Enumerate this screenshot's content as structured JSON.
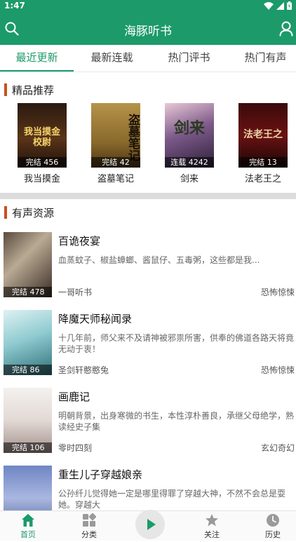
{
  "status_bar": {
    "time": "1:47"
  },
  "header": {
    "title": "海豚听书"
  },
  "tabs": [
    {
      "label": "最近更新",
      "active": true
    },
    {
      "label": "最新连载",
      "active": false
    },
    {
      "label": "热门评书",
      "active": false
    },
    {
      "label": "热门有声",
      "active": false
    }
  ],
  "featured": {
    "section_title": "精品推荐",
    "items": [
      {
        "title": "我当摸金",
        "badge": "完结 456",
        "cover_text": "我当摸金校尉"
      },
      {
        "title": "盗墓笔记",
        "badge": "完结 42",
        "cover_text": "盗墓笔记"
      },
      {
        "title": "剑来",
        "badge": "连载 4242",
        "cover_text": "剑来"
      },
      {
        "title": "法老王之",
        "badge": "完结 13",
        "cover_text": "法老王之"
      }
    ]
  },
  "audio": {
    "section_title": "有声资源",
    "items": [
      {
        "title": "百诡夜宴",
        "badge": "完结 478",
        "desc": "血蒸蚊子、椒盐蟑螂、酱鼠仔、五毒粥，这些都是我...",
        "author": "一哥听书",
        "genre": "恐怖惊悚"
      },
      {
        "title": "降魔天师秘闻录",
        "badge": "完结 86",
        "desc": "十几年前，师父来不及请神被邪祟所害，供奉的佛道各路天将竟无动于衷！",
        "author": "圣剑轩憨憨兔",
        "genre": "恐怖惊悚"
      },
      {
        "title": "画鹿记",
        "badge": "完结 106",
        "desc": "明朝背景，出身寒微的书生，本性淳朴善良，承继父母绝学，熟读经史子集",
        "author": "零时四刻",
        "genre": "玄幻奇幻"
      },
      {
        "title": "重生儿子穿越娘亲",
        "badge": "",
        "desc": "公孙纤儿觉得她一定是哪里得罪了穿越大神，不然不会总是耍她。穿越大",
        "author": "",
        "genre": ""
      }
    ]
  },
  "bottom_nav": [
    {
      "label": "首页",
      "icon": "home-icon",
      "active": true
    },
    {
      "label": "分类",
      "icon": "category-icon",
      "active": false
    },
    {
      "label": "",
      "icon": "play-icon",
      "active": false
    },
    {
      "label": "关注",
      "icon": "star-icon",
      "active": false
    },
    {
      "label": "历史",
      "icon": "clock-icon",
      "active": false
    }
  ],
  "colors": {
    "brand": "#1c9a6a",
    "section_accent": "#c8501e"
  }
}
